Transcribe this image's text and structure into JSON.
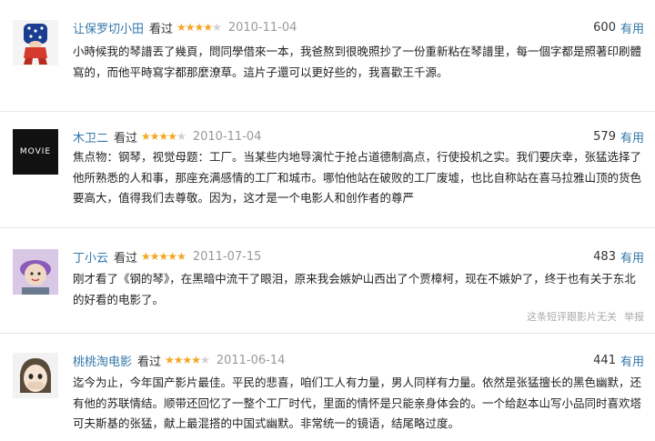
{
  "reviews": [
    {
      "user": "让保罗切小田",
      "watched": "看过",
      "stars": 4,
      "date": "2010-11-04",
      "votes": "600",
      "useful": "有用",
      "content": "小時候我的琴譜丟了幾頁，問同學借來一本，我爸熬到很晚照抄了一份重新粘在琴譜里，每一個字都是照著印刷體寫的，而他平時寫字都那麼潦草。這片子還可以更好些的，我喜歡王千源。"
    },
    {
      "user": "木卫二",
      "watched": "看过",
      "stars": 4,
      "date": "2010-11-04",
      "votes": "579",
      "useful": "有用",
      "avatar_text": "MOVIE",
      "content": "焦点物：钢琴，视觉母题：工厂。当某些内地导演忙于抢占道德制高点，行使投机之实。我们要庆幸，张猛选择了他所熟悉的人和事，那座充满感情的工厂和城市。哪怕他站在破败的工厂废墟，也比自称站在喜马拉雅山顶的货色要高大，值得我们去尊敬。因为，这才是一个电影人和创作者的尊严"
    },
    {
      "user": "丁小云",
      "watched": "看过",
      "stars": 5,
      "date": "2011-07-15",
      "votes": "483",
      "useful": "有用",
      "content": "刚才看了《钢的琴》，在黑暗中流干了眼泪，原来我会嫉妒山西出了个贾樟柯，现在不嫉妒了，终于也有关于东北的好看的电影了。",
      "extra_text": "这条短评跟影片无关",
      "report_text": "举报"
    },
    {
      "user": "桃桃淘电影",
      "watched": "看过",
      "stars": 4,
      "date": "2011-06-14",
      "votes": "441",
      "useful": "有用",
      "content": "迄今为止，今年国产影片最佳。平民的悲喜，咱们工人有力量，男人同样有力量。依然是张猛擅长的黑色幽默，还有他的苏联情结。顺带还回忆了一整个工厂时代，里面的情怀是只能亲身体会的。一个给赵本山写小品同时喜欢塔可夫斯基的张猛，献上最混搭的中国式幽默。非常统一的镜语，结尾略过度。"
    }
  ],
  "colors": {
    "link": "#3377aa",
    "star": "#f5a623",
    "muted": "#999999"
  },
  "icons": [
    "star-icon"
  ]
}
